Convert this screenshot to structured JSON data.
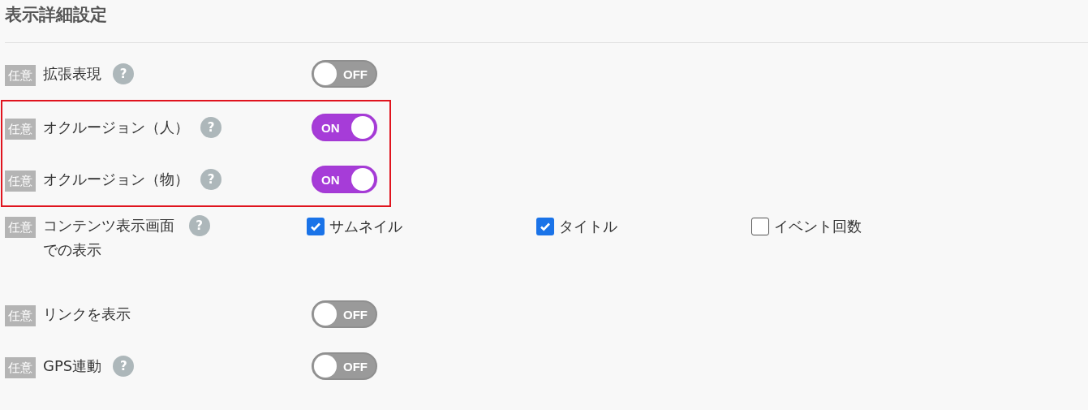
{
  "title": "表示詳細設定",
  "rows": [
    {
      "kind": "toggle",
      "badge": "任意",
      "label": "拡張表現",
      "help": "?",
      "highlighted": false,
      "on": false,
      "toggle_text": "OFF"
    },
    {
      "kind": "toggle",
      "badge": "任意",
      "label": "オクルージョン（人）",
      "help": "?",
      "highlighted": true,
      "on": true,
      "toggle_text": "ON"
    },
    {
      "kind": "toggle",
      "badge": "任意",
      "label": "オクルージョン（物）",
      "help": "?",
      "highlighted": true,
      "on": true,
      "toggle_text": "ON"
    },
    {
      "kind": "checkboxes",
      "badge": "任意",
      "label": "コンテンツ表示画面での表示",
      "help": "?",
      "highlighted": false,
      "options": [
        {
          "label": "サムネイル",
          "checked": true
        },
        {
          "label": "タイトル",
          "checked": true
        },
        {
          "label": "イベント回数",
          "checked": false
        }
      ]
    },
    {
      "kind": "toggle",
      "badge": "任意",
      "label": "リンクを表示",
      "highlighted": false,
      "on": false,
      "toggle_text": "OFF"
    },
    {
      "kind": "toggle",
      "badge": "任意",
      "label": "GPS連動",
      "help": "?",
      "highlighted": false,
      "on": false,
      "toggle_text": "OFF"
    }
  ]
}
